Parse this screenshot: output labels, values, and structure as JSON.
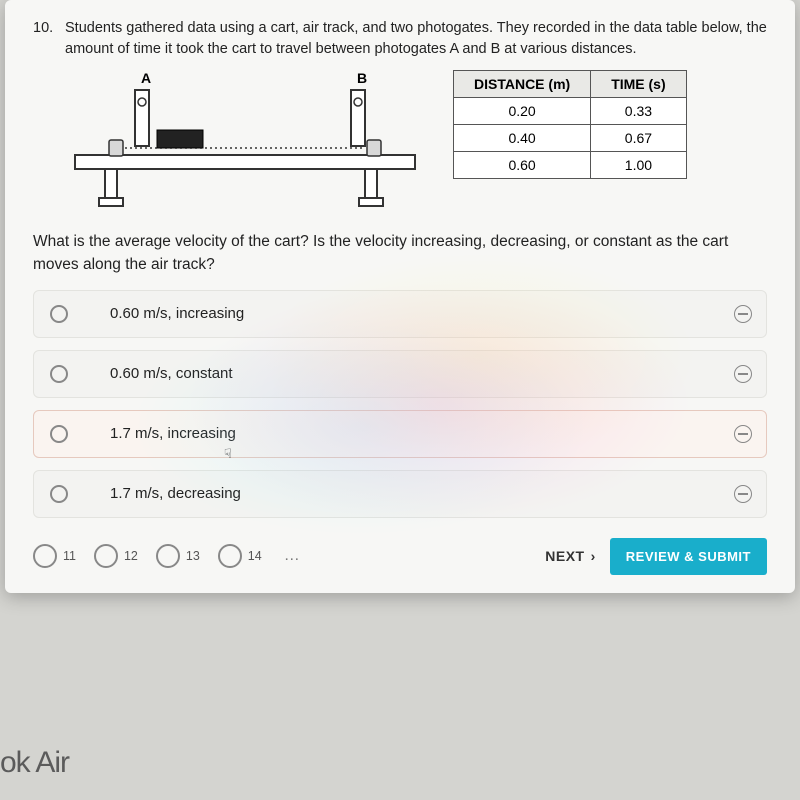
{
  "question": {
    "number": "10.",
    "stem": "Students gathered data using a cart, air track, and two photogates. They recorded in the data table below, the amount of time it took the cart to travel between photogates A and B at various distances.",
    "sub": "What is the average velocity of the cart? Is the velocity increasing, decreasing, or constant as the cart moves along the air track?"
  },
  "diagram": {
    "labelA": "A",
    "labelB": "B"
  },
  "table": {
    "headers": [
      "DISTANCE (m)",
      "TIME (s)"
    ],
    "rows": [
      [
        "0.20",
        "0.33"
      ],
      [
        "0.40",
        "0.67"
      ],
      [
        "0.60",
        "1.00"
      ]
    ]
  },
  "options": [
    {
      "text": "0.60 m/s, increasing",
      "hover": false
    },
    {
      "text": "0.60 m/s, constant",
      "hover": false
    },
    {
      "text": "1.7 m/s, increasing",
      "hover": true
    },
    {
      "text": "1.7 m/s, decreasing",
      "hover": false
    }
  ],
  "nav": {
    "items": [
      "11",
      "12",
      "13",
      "14"
    ],
    "ellipsis": "…",
    "next": "NEXT",
    "review": "REVIEW & SUBMIT"
  },
  "device": "ok Air"
}
